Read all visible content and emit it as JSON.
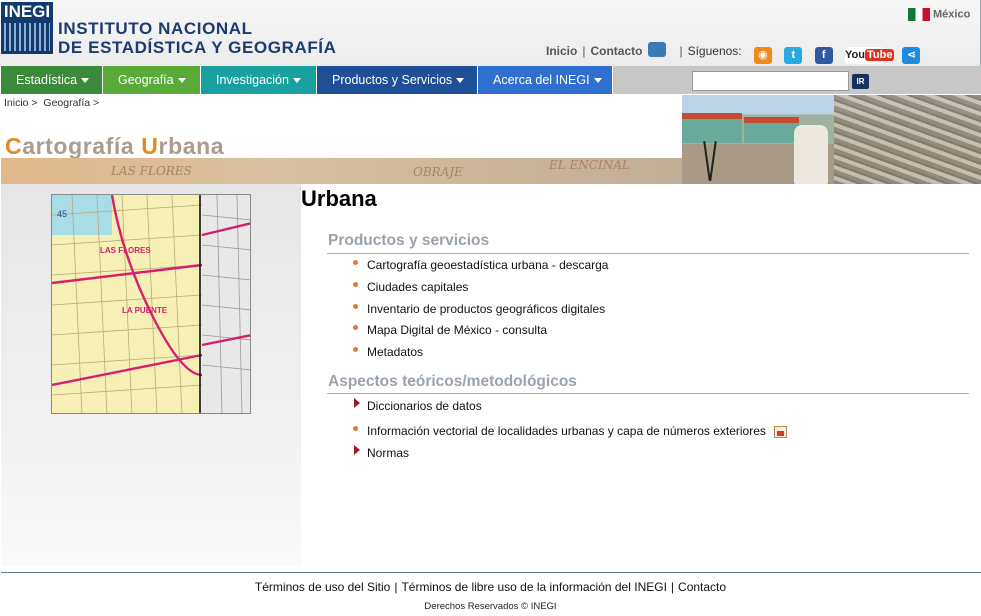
{
  "header": {
    "logo_text": "INEGI",
    "institution_line1": "INSTITUTO NACIONAL",
    "institution_line2": "DE ESTADÍSTICA Y GEOGRAFÍA",
    "country_label": "México",
    "links": {
      "inicio": "Inicio",
      "contacto": "Contacto",
      "siguenos": "Síguenos:"
    },
    "social": {
      "youtube_you": "You",
      "youtube_tube": "Tube"
    }
  },
  "nav": {
    "items": [
      {
        "label": "Estadística",
        "color": "#3a8a3a"
      },
      {
        "label": "Geografía",
        "color": "#5aaa3a"
      },
      {
        "label": "Investigación",
        "color": "#19a0a0"
      },
      {
        "label": "Productos y Servicios",
        "color": "#1f4f96"
      },
      {
        "label": "Acerca del INEGI",
        "color": "#2e6fd0"
      }
    ],
    "search_value": "",
    "search_button": "IR"
  },
  "breadcrumb": [
    "Inicio",
    "Geografía"
  ],
  "banner": {
    "title_cap1": "C",
    "title_rest1": "artografía ",
    "title_cap2": "U",
    "title_rest2": "rbana",
    "strip_text_1": "LAS FLORES",
    "strip_text_2": "OBRAJE",
    "strip_text_3": "EL ENCINAL"
  },
  "main": {
    "title": "Urbana",
    "sections": [
      {
        "title": "Productos y servicios",
        "items": [
          "Cartografía geoestadística urbana - descarga",
          "Ciudades capitales",
          "Inventario de productos geográficos digitales",
          "Mapa Digital de México - consulta",
          "Metadatos"
        ]
      },
      {
        "title": "Aspectos teóricos/metodológicos",
        "items": [
          "Diccionarios de datos",
          "Información vectorial de localidades urbanas y capa de números exteriores",
          "Normas"
        ]
      }
    ]
  },
  "map": {
    "label_1": "LAS FLORES",
    "label_2": "LA PUENTE",
    "label_3": "45"
  },
  "footer": {
    "links": [
      "Términos de uso del Sitio",
      "Términos de libre uso de la información del INEGI",
      "Contacto"
    ],
    "copyright": "Derechos Reservados © INEGI"
  },
  "icons": {
    "bullet_color": "#e07b3a",
    "arrow_color": "#9b1c1c",
    "section_rule_color": "#c8a98a"
  }
}
